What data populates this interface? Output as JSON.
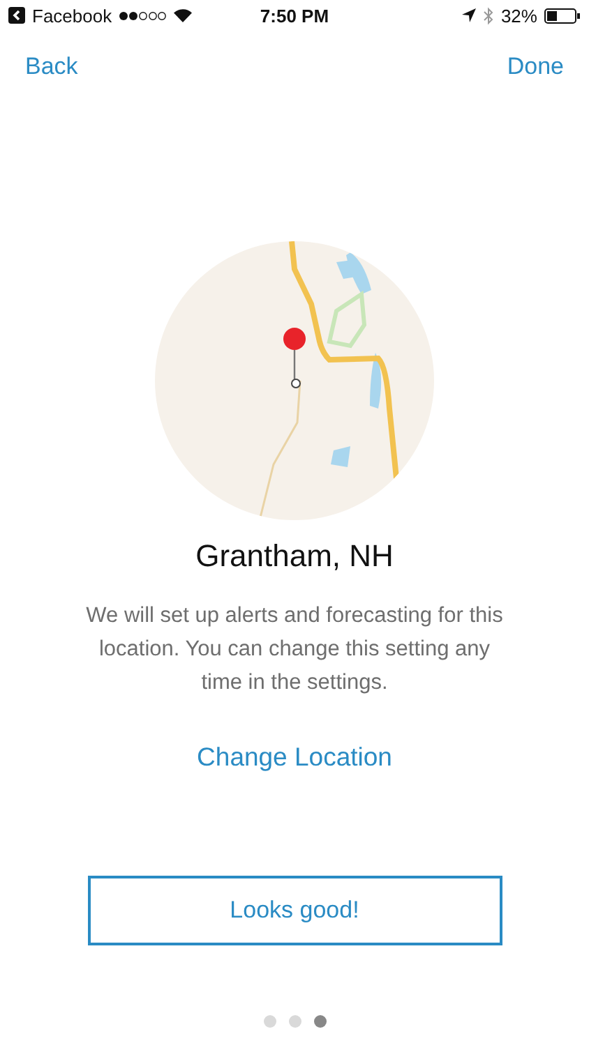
{
  "status_bar": {
    "back_app": "Facebook",
    "time": "7:50 PM",
    "battery": "32%"
  },
  "nav": {
    "back": "Back",
    "done": "Done"
  },
  "location": "Grantham, NH",
  "description": "We will set up alerts and forecasting for this location.  You can change this setting any time in the settings.",
  "change_link": "Change Location",
  "confirm_button": "Looks good!",
  "pages": [
    {
      "selected": false
    },
    {
      "selected": false
    },
    {
      "selected": true
    }
  ]
}
